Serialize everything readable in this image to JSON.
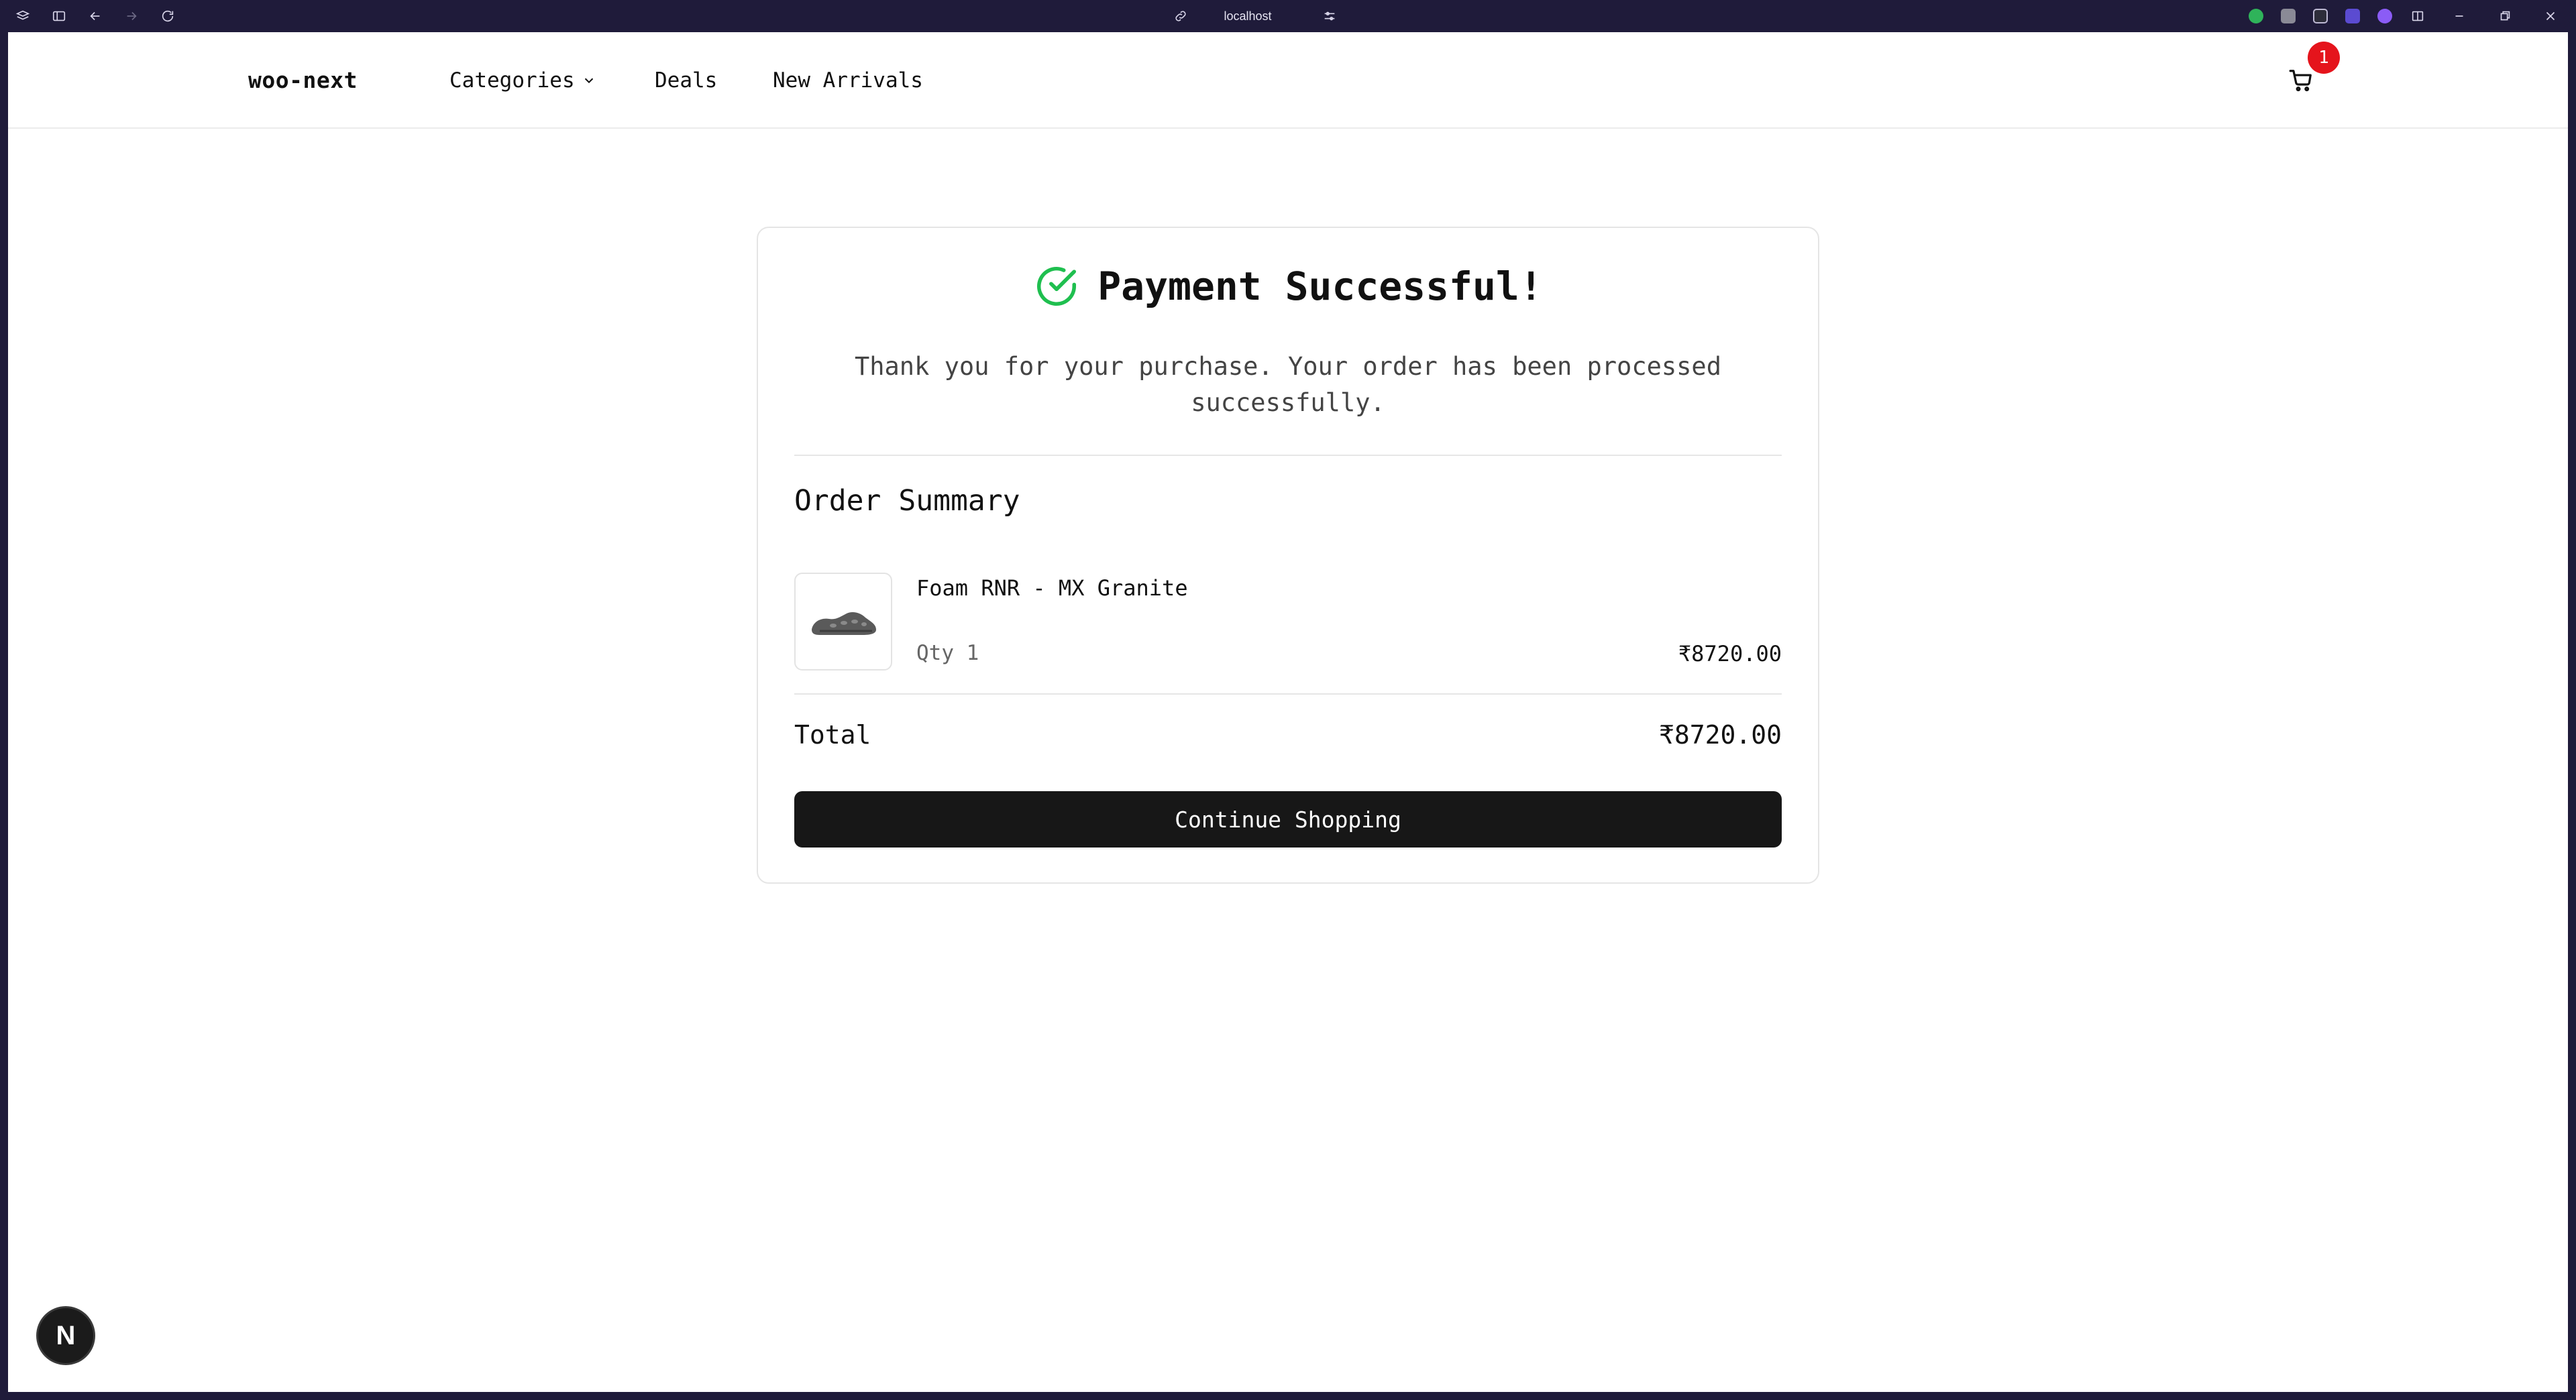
{
  "browser": {
    "url": "localhost",
    "icons": {
      "tabs": "tabs-icon",
      "sidebar": "sidebar-icon",
      "back": "back-icon",
      "forward": "forward-icon",
      "reload": "reload-icon",
      "link": "link-icon",
      "site-settings": "settings-icon"
    }
  },
  "header": {
    "logo": "woo-next",
    "nav": {
      "categories": "Categories",
      "deals": "Deals",
      "new_arrivals": "New Arrivals"
    },
    "cart_count": "1"
  },
  "confirmation": {
    "title": "Payment Successful!",
    "message": "Thank you for your purchase. Your order has been processed successfully.",
    "summary_title": "Order Summary",
    "items": [
      {
        "name": "Foam RNR - MX Granite",
        "qty_label": "Qty 1",
        "price": "₹8720.00"
      }
    ],
    "total_label": "Total",
    "total_value": "₹8720.00",
    "continue_label": "Continue Shopping"
  },
  "dev_badge": {
    "label": "N"
  },
  "colors": {
    "success": "#1fbf4f",
    "badge": "#e5141c",
    "button": "#171717",
    "chrome": "#1f1b3a"
  }
}
